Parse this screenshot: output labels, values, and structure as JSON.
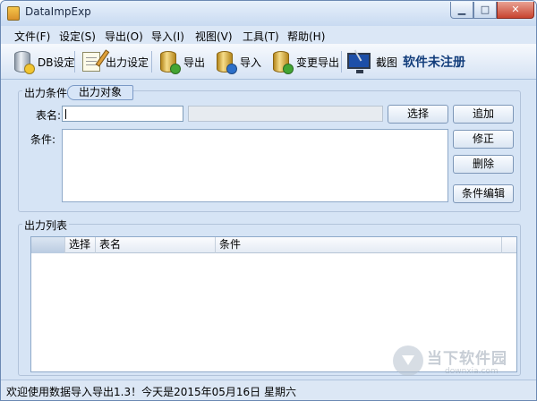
{
  "window": {
    "title": "DataImpExp"
  },
  "menu": [
    "文件(F)",
    "设定(S)",
    "导出(O)",
    "导入(I)",
    "视图(V)",
    "工具(T)",
    "帮助(H)"
  ],
  "toolbar": {
    "db_settings": "DB设定",
    "output_settings": "出力设定",
    "export": "导出",
    "import": "导入",
    "change_export": "变更导出",
    "screenshot": "截图",
    "unregistered": "软件未注册"
  },
  "condition_panel": {
    "title": "出力条件",
    "tab": "出力对象",
    "table_name_label": "表名:",
    "table_name_value": "",
    "condition_label": "条件:",
    "condition_value": "",
    "select_button": "选择",
    "add_button": "追加",
    "modify_button": "修正",
    "delete_button": "删除",
    "edit_button": "条件编辑"
  },
  "output_list": {
    "title": "出力列表",
    "columns": [
      "选择",
      "表名",
      "条件"
    ],
    "rows": []
  },
  "status": {
    "message": "欢迎使用数据导入导出1.3！今天是2015年05月16日   星期六"
  },
  "watermark": {
    "brand": "当下软件园",
    "url": "downxia.com"
  }
}
